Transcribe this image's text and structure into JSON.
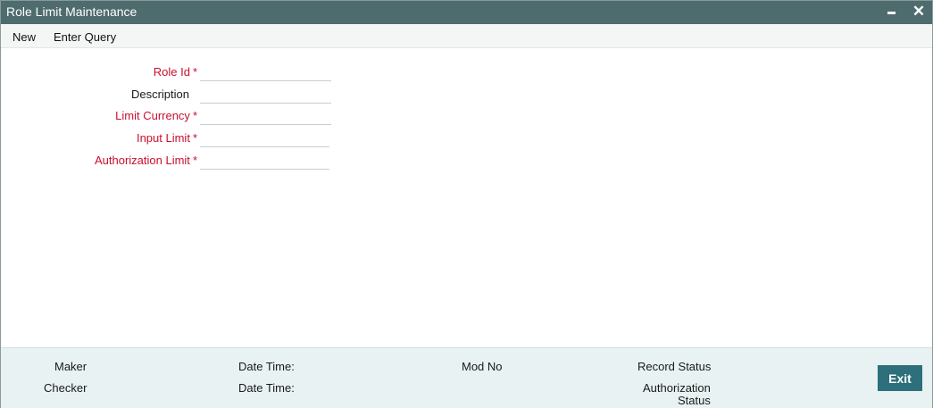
{
  "window": {
    "title": "Role Limit Maintenance"
  },
  "menubar": {
    "items": [
      {
        "label": "New"
      },
      {
        "label": "Enter Query"
      }
    ]
  },
  "form": {
    "fields": [
      {
        "label": "Role Id",
        "required": true,
        "value": ""
      },
      {
        "label": "Description",
        "required": false,
        "value": ""
      },
      {
        "label": "Limit Currency",
        "required": true,
        "value": ""
      },
      {
        "label": "Input Limit",
        "required": true,
        "value": ""
      },
      {
        "label": "Authorization Limit",
        "required": true,
        "value": ""
      }
    ],
    "asterisk": "*"
  },
  "footer": {
    "maker_label": "Maker",
    "checker_label": "Checker",
    "date_time_label_1": "Date Time:",
    "date_time_label_2": "Date Time:",
    "mod_no_label": "Mod No",
    "record_status_label": "Record Status",
    "authorization_status_line1": "Authorization",
    "authorization_status_line2": "Status",
    "exit_label": "Exit"
  },
  "colors": {
    "titlebar": "#4e6c6d",
    "required_label": "#c8102e",
    "footer_bg": "#e8f2f2",
    "exit_button": "#2d6f7a"
  },
  "icons": {
    "minimize": "minimize-icon",
    "close": "close-icon"
  }
}
